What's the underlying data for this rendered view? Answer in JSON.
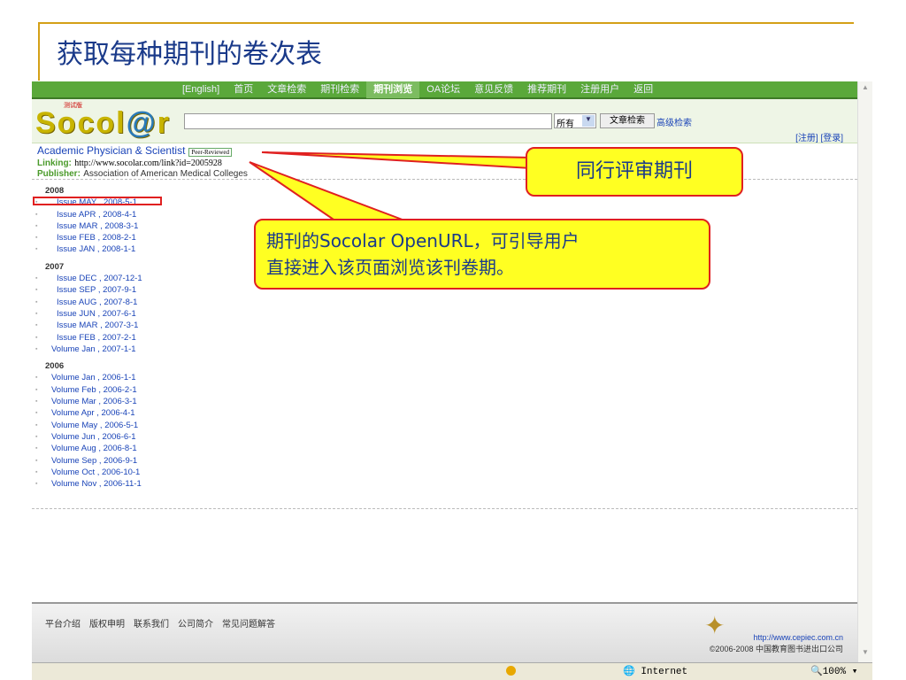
{
  "slide": {
    "title": "获取每种期刊的卷次表"
  },
  "nav": {
    "items": [
      "[English]",
      "首页",
      "文章检索",
      "期刊检索",
      "期刊浏览",
      "OA论坛",
      "意见反馈",
      "推荐期刊",
      "注册用户",
      "返回"
    ]
  },
  "header": {
    "logo": "Socol@r",
    "logo_sub": "测试版",
    "select": "所有",
    "search_button": "文章检索",
    "advanced": "高级检索",
    "register": "[注册]",
    "login": "[登录]"
  },
  "journal": {
    "title": "Academic Physician & Scientist",
    "badge": "Peer-Reviewed",
    "linking_label": "Linking:",
    "linking": "http://www.socolar.com/link?id=2005928",
    "publisher_label": "Publisher:",
    "publisher": "Association of American Medical Colleges"
  },
  "issues": [
    {
      "year": "2008",
      "items": [
        "Issue MAY , 2008-5-1",
        "Issue APR , 2008-4-1",
        "Issue MAR , 2008-3-1",
        "Issue FEB , 2008-2-1",
        "Issue JAN , 2008-1-1"
      ]
    },
    {
      "year": "2007",
      "items": [
        "Issue DEC , 2007-12-1",
        "Issue SEP , 2007-9-1",
        "Issue AUG , 2007-8-1",
        "Issue JUN , 2007-6-1",
        "Issue MAR , 2007-3-1",
        "Issue FEB , 2007-2-1",
        "Volume Jan , 2007-1-1"
      ]
    },
    {
      "year": "2006",
      "items": [
        "Volume Jan , 2006-1-1",
        "Volume Feb , 2006-2-1",
        "Volume Mar , 2006-3-1",
        "Volume Apr , 2006-4-1",
        "Volume May , 2006-5-1",
        "Volume Jun , 2006-6-1",
        "Volume Aug , 2006-8-1",
        "Volume Sep , 2006-9-1",
        "Volume Oct , 2006-10-1",
        "Volume Nov , 2006-11-1"
      ]
    }
  ],
  "footer": {
    "links": [
      "平台介绍",
      "版权申明",
      "联系我们",
      "公司简介",
      "常见问题解答"
    ],
    "url": "http://www.cepiec.com.cn",
    "copyright": "©2006-2008 中国教育图书进出口公司"
  },
  "status": {
    "zone": "Internet",
    "zoom": "100%"
  },
  "callouts": {
    "c1": "同行评审期刊",
    "c2_line1": "期刊的Socolar OpenURL，可引导用户",
    "c2_line2": "直接进入该页面浏览该刊卷期。"
  }
}
